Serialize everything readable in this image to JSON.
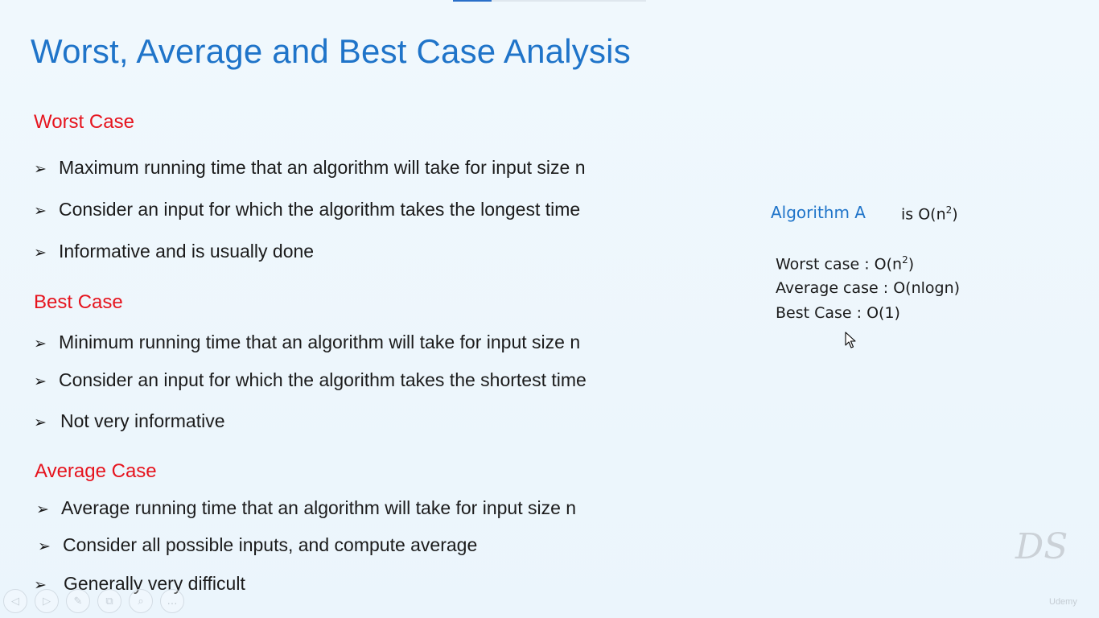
{
  "slide": {
    "title": "Worst, Average and Best Case Analysis",
    "sections": [
      {
        "heading": "Worst Case",
        "bullets": [
          "Maximum running time that an algorithm will take for input size n",
          "Consider an input for which the algorithm takes the longest time",
          "Informative and is usually done"
        ]
      },
      {
        "heading": "Best Case",
        "bullets": [
          "Minimum running time that an algorithm will take for input size n",
          "Consider an input for which the algorithm takes the shortest time",
          "Not very informative"
        ]
      },
      {
        "heading": "Average Case",
        "bullets": [
          "Average running time that an algorithm will take for input size n",
          "Consider all possible inputs, and compute average",
          "Generally very difficult"
        ]
      }
    ],
    "bullet_icon": "arrow-bullet-icon",
    "side_panel": {
      "algorithm_name": "Algorithm A",
      "complexity_prefix": "is O(n",
      "complexity_exp": "2",
      "complexity_suffix": ")",
      "cases": {
        "worst_prefix": "Worst case : O(n",
        "worst_exp": "2",
        "worst_suffix": ")",
        "average": "Average case : O(nlogn)",
        "best": "Best Case : O(1)"
      }
    },
    "logo_text": "DS",
    "watermark_text": "Udemy",
    "colors": {
      "title": "#1f74c9",
      "heading": "#e6141e",
      "body_text": "#1b1b1b",
      "accent": "#1f74c9"
    }
  },
  "controls": [
    {
      "name": "previous-slide-button",
      "icon": "arrow-left-icon",
      "glyph": "◁"
    },
    {
      "name": "next-slide-button",
      "icon": "arrow-right-icon",
      "glyph": "▷"
    },
    {
      "name": "pen-tool-button",
      "icon": "pen-icon",
      "glyph": "✎"
    },
    {
      "name": "slides-overview-button",
      "icon": "slides-icon",
      "glyph": "⧉"
    },
    {
      "name": "zoom-button",
      "icon": "magnifier-icon",
      "glyph": "⌕"
    },
    {
      "name": "more-options-button",
      "icon": "more-icon",
      "glyph": "…"
    }
  ]
}
